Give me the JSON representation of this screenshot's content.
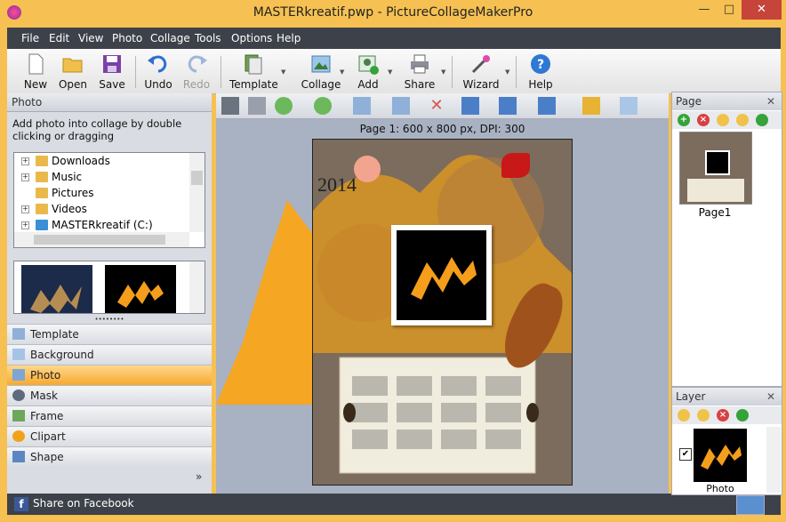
{
  "window": {
    "title": "MASTERkreatif.pwp - PictureCollageMakerPro",
    "controls": [
      "—",
      "□",
      "✕"
    ]
  },
  "menu": [
    "File",
    "Edit",
    "View",
    "Photo",
    "Collage",
    "Tools",
    "Options",
    "Help"
  ],
  "toolbar": {
    "new": "New",
    "open": "Open",
    "save": "Save",
    "undo": "Undo",
    "redo": "Redo",
    "template": "Template",
    "collage": "Collage",
    "add": "Add",
    "share": "Share",
    "wizard": "Wizard",
    "help": "Help"
  },
  "left_panel": {
    "title": "Photo",
    "hint": "Add photo into collage by double clicking or dragging",
    "tree": [
      "Downloads",
      "Music",
      "Pictures",
      "Videos",
      "MASTERkreatif (C:)"
    ],
    "accordion": [
      "Template",
      "Background",
      "Photo",
      "Mask",
      "Frame",
      "Clipart",
      "Shape"
    ],
    "selected": "Photo",
    "grip": "••••••••",
    "more": "»"
  },
  "canvas": {
    "page_info": "Page 1: 600 x 800 px, DPI: 300",
    "year_text": "2014"
  },
  "page_panel": {
    "title": "Page",
    "thumb_label": "Page1",
    "close": "✕"
  },
  "layer_panel": {
    "title": "Layer",
    "layer_label": "Photo",
    "checked": "✔",
    "close": "✕"
  },
  "status": {
    "share": "Share on Facebook"
  },
  "colors": {
    "accent": "#f6c152",
    "dark": "#3d4149",
    "logo_orange": "#f59e1c"
  }
}
